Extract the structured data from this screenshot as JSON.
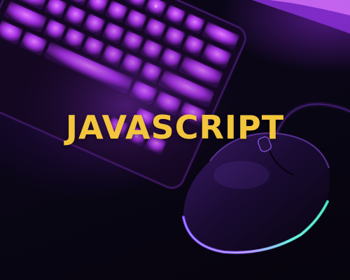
{
  "banner": {
    "title": "JAVASCRIPT",
    "title_color": "#f2c53d"
  },
  "scene": {
    "description_icons": [
      "keyboard-icon",
      "mouse-icon"
    ],
    "accent_colors": {
      "key_glow": "#d24bff",
      "mouse_rim_glow": "#3fe0d0",
      "background": "#07040f"
    }
  }
}
